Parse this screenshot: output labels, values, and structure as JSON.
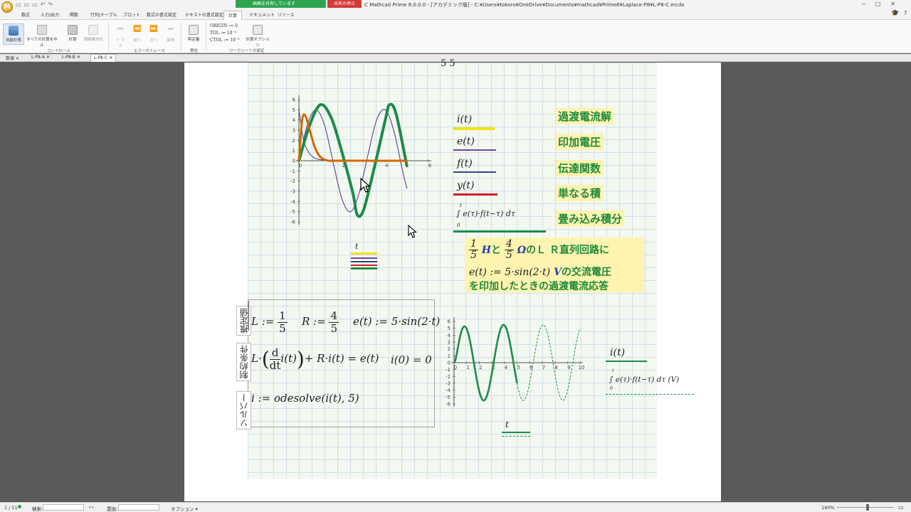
{
  "window": {
    "orb": "M",
    "title": "C Mathcad Prime 8.0.0.0 - [アカデミック版] - C:¥Users¥tokoro¥OneDrive¥Documents¥mathcad¥Prime8¥Laplace-P8¥L-P8-C.mcdx",
    "share_label": "画面を共有しています",
    "share_stop": "共有の停止"
  },
  "ribbon_tabs": [
    "数式",
    "入力/出力",
    "関数",
    "行列/テーブル",
    "プロット",
    "数式の書式設定",
    "テキストの書式設定",
    "計算",
    "ドキュメント",
    "リソース"
  ],
  "active_tab": "計算",
  "ribbon": {
    "auto_calc": "自動計算",
    "abort_all": "すべての計算を中止",
    "calculate": "計算",
    "disable_calc": "領域無効化",
    "trace_btns": [
      "ト ラ ス",
      "前へ",
      "次へ",
      "最後"
    ],
    "recalc": "再定義",
    "calc_options": "計算オプション",
    "groups": [
      "コントロール",
      "エラーのトレース",
      "警告",
      "ワークシートの設定"
    ],
    "origin": "ORIGIN := 0",
    "tol": "TOL := 10⁻³",
    "ctol": "CTOL := 10⁻³"
  },
  "doc_tabs": [
    "数値",
    "L-P8-A",
    "L-P8-B",
    "L-P8-C"
  ],
  "active_doc": "L-P8-C",
  "sheet": {
    "top_fragment": "5      5",
    "legend": {
      "i": "i(t)",
      "e": "e(t)",
      "f": "f(t)",
      "y": "y(t)",
      "conv": "∫ e(τ)·f(t−τ) dτ",
      "conv_upper": "t",
      "conv_lower": "0"
    },
    "labels": {
      "i": "過渡電流解",
      "e": "印加電圧",
      "f": "伝達関数",
      "y": "単なる積",
      "conv": "畳み込み積分"
    },
    "plot1_xvar": "t",
    "info": {
      "frac1_num": "1",
      "frac1_den": "5",
      "h_unit": "H",
      "and": "と",
      "frac2_num": "4",
      "frac2_den": "5",
      "ohm": "Ω",
      "circuit": "のＬ Ｒ直列回路に",
      "line2_math": "e(t) := 5·sin(2·t)",
      "v_unit": "V",
      "line2_text": "の交流電圧",
      "line3": "を印加したときの過渡電流応答"
    },
    "side_labels": [
      "推定値",
      "制約条件",
      "ソルバー"
    ],
    "defs": {
      "L": "L :=",
      "L_num": "1",
      "L_den": "5",
      "R": "R :=",
      "R_num": "4",
      "R_den": "5",
      "e": "e(t) := 5·sin(2·t)"
    },
    "constraint": {
      "lhs": "L·",
      "d": "d",
      "dt": "dt",
      "it": "i(t)",
      "rest": "+ R·i(t) = e(t)",
      "init": "i(0) = 0"
    },
    "solver": "i := odesolve(i(t), 5)",
    "plot2_legend_i": "i(t)",
    "plot2_legend_conv": "∫ e(τ)·f(t−τ) dτ   (V)",
    "plot2_conv_upper": "t",
    "plot2_conv_lower": "0",
    "plot2_xvar": "t"
  },
  "statusbar": {
    "page": "1 / 11",
    "search": "検索:",
    "replace": "置換:",
    "options": "オプション ▾",
    "zoom": "190%"
  },
  "chart_data": [
    {
      "type": "line",
      "x_range": [
        0,
        6
      ],
      "ylim": [
        -6,
        6
      ],
      "x_ticks": [
        0,
        2,
        4,
        6
      ],
      "y_ticks": [
        -6,
        -5,
        -4,
        -3,
        -2,
        -1,
        0,
        1,
        2,
        3,
        4,
        5,
        6
      ],
      "series": [
        {
          "name": "i(t)",
          "color": "#1e8a4a",
          "points": [
            [
              0,
              0
            ],
            [
              0.5,
              3.5
            ],
            [
              1.0,
              5.5
            ],
            [
              1.5,
              4.2
            ],
            [
              2.0,
              0.8
            ],
            [
              2.5,
              -3.2
            ],
            [
              2.7,
              -5.3
            ],
            [
              3.0,
              -4.8
            ],
            [
              3.5,
              -0.6
            ],
            [
              4.0,
              4.0
            ],
            [
              4.2,
              5.5
            ],
            [
              4.5,
              4.6
            ],
            [
              5.0,
              -0.5
            ]
          ]
        },
        {
          "name": "e(t)",
          "color": "#6a4a9a",
          "points": [
            [
              0,
              0
            ],
            [
              0.4,
              3.6
            ],
            [
              0.8,
              5.0
            ],
            [
              1.2,
              3.4
            ],
            [
              1.6,
              -0.3
            ],
            [
              2.0,
              -3.8
            ],
            [
              2.4,
              -5.0
            ],
            [
              2.8,
              -3.1
            ],
            [
              3.2,
              0.6
            ],
            [
              3.6,
              4.0
            ],
            [
              4.0,
              5.0
            ],
            [
              4.4,
              2.9
            ],
            [
              4.8,
              -1.0
            ],
            [
              5.0,
              -2.7
            ]
          ]
        },
        {
          "name": "f(t)",
          "color": "#334488",
          "points": [
            [
              0,
              5
            ],
            [
              0.2,
              2.2
            ],
            [
              0.4,
              1.0
            ],
            [
              0.7,
              0.3
            ],
            [
              1.2,
              0.05
            ],
            [
              2,
              0
            ],
            [
              5,
              0
            ]
          ]
        },
        {
          "name": "y(t)",
          "color": "#d06a00",
          "points": [
            [
              0,
              0
            ],
            [
              0.15,
              4.0
            ],
            [
              0.3,
              4.4
            ],
            [
              0.5,
              3.0
            ],
            [
              0.8,
              1.0
            ],
            [
              1.2,
              0.1
            ],
            [
              2,
              0
            ],
            [
              5,
              0
            ]
          ]
        }
      ]
    },
    {
      "type": "line",
      "x_range": [
        0,
        10
      ],
      "ylim": [
        -6,
        6
      ],
      "x_ticks": [
        0,
        1,
        2,
        3,
        4,
        5,
        6,
        7,
        8,
        9,
        10
      ],
      "y_ticks": [
        -6,
        -5,
        -4,
        -3,
        -2,
        -1,
        0,
        1,
        2,
        3,
        4,
        5,
        6
      ],
      "series": [
        {
          "name": "i(t)",
          "color": "#1e8a4a",
          "style": "solid",
          "x_extent": [
            0,
            5
          ],
          "amplitude": 5.5,
          "frequency": 2
        },
        {
          "name": "∫ e(τ)·f(t−τ) dτ",
          "color": "#1e8a4a",
          "style": "dashed",
          "x_extent": [
            5,
            10
          ],
          "amplitude": 5.5,
          "frequency": 2
        }
      ]
    }
  ]
}
